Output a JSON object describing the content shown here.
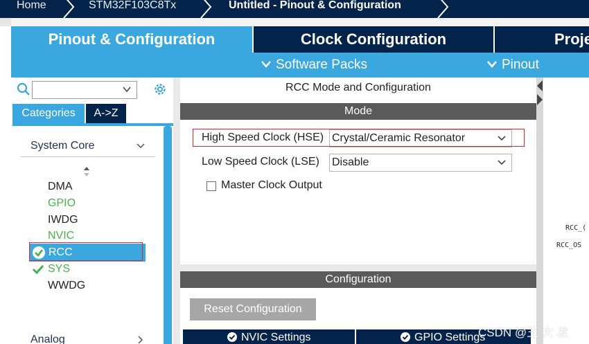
{
  "colors": {
    "navy": "#03234b",
    "accent_blue": "#3aa8df",
    "green": "#45b14b",
    "header_gray": "#5a5a5a",
    "highlight_red": "#e0262b"
  },
  "breadcrumb": {
    "home": "Home",
    "device": "STM32F103C8Tx",
    "current": "Untitled - Pinout & Configuration"
  },
  "main_tabs": [
    "Pinout & Configuration",
    "Clock Configuration",
    "Proje"
  ],
  "sub_tabs": {
    "software_packs": "Software Packs",
    "pinout": "Pinout"
  },
  "sidebar": {
    "search": {
      "value": ""
    },
    "category_tabs": [
      "Categories",
      "A->Z"
    ],
    "group_system_core": "System Core",
    "group_analog": "Analog",
    "items": [
      {
        "label": "DMA",
        "color": "#222222",
        "checked": false
      },
      {
        "label": "GPIO",
        "color": "#45b14b",
        "checked": false
      },
      {
        "label": "IWDG",
        "color": "#222222",
        "checked": false
      },
      {
        "label": "NVIC",
        "color": "#45b14b",
        "checked": false
      },
      {
        "label": "RCC",
        "color": "#ffffff",
        "checked": true,
        "selected": true
      },
      {
        "label": "SYS",
        "color": "#45b14b",
        "checked": true
      },
      {
        "label": "WWDG",
        "color": "#222222",
        "checked": false
      }
    ]
  },
  "mode_panel": {
    "title": "RCC Mode and Configuration",
    "mode_header": "Mode",
    "hse_label": "High Speed Clock (HSE)",
    "hse_value": "Crystal/Ceramic Resonator",
    "lse_label": "Low Speed Clock (LSE)",
    "lse_value": "Disable",
    "mco_label": "Master Clock Output",
    "mco_checked": false
  },
  "config_panel": {
    "header": "Configuration",
    "reset_button": "Reset Configuration",
    "tabs": [
      "NVIC Settings",
      "GPIO Settings"
    ]
  },
  "pinout": {
    "pin1": "RCC_(",
    "pin2": "RCC_OS"
  },
  "watermark": "CSDN @王 大 发"
}
